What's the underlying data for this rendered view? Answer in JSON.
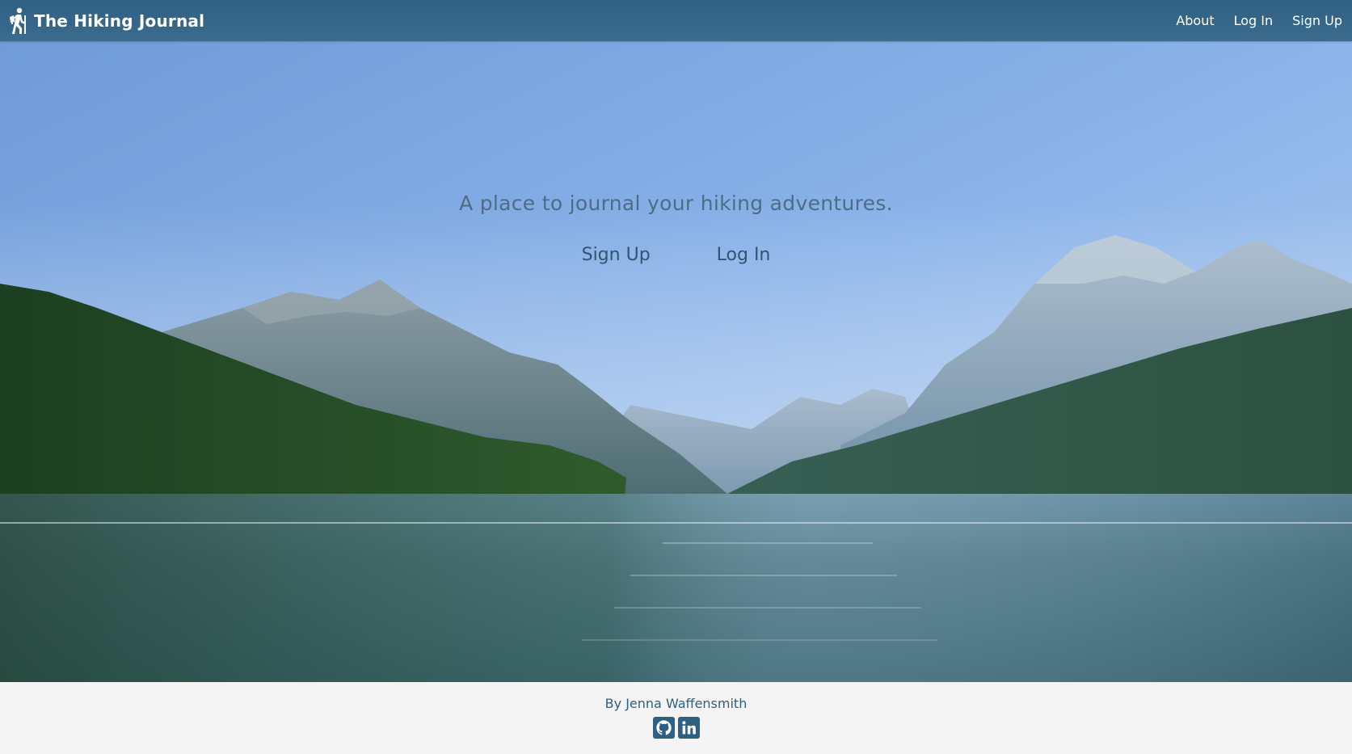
{
  "brand": {
    "title": "The Hiking Journal",
    "icon": "hiker-icon"
  },
  "nav": {
    "links": [
      "About",
      "Log In",
      "Sign Up"
    ]
  },
  "hero": {
    "tagline": "A place to journal your hiking adventures.",
    "signup_label": "Sign Up",
    "login_label": "Log In"
  },
  "footer": {
    "byline": "By Jenna Waffensmith",
    "icons": [
      "github-icon",
      "linkedin-icon"
    ]
  },
  "colors": {
    "navbar": "#2f5f83",
    "accent": "#2f5f83",
    "footer_bg": "#f4f4f4",
    "tagline": "#4d6d86"
  }
}
